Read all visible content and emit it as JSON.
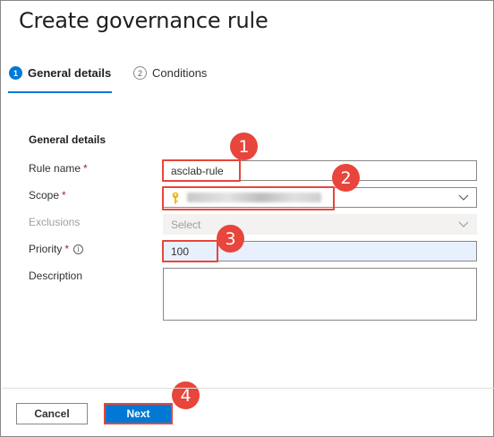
{
  "dialog": {
    "title": "Create governance rule"
  },
  "steps": [
    {
      "number": "1",
      "label": "General details",
      "active": true
    },
    {
      "number": "2",
      "label": "Conditions",
      "active": false
    }
  ],
  "form": {
    "section_title": "General details",
    "rule_name": {
      "label": "Rule name",
      "required_mark": "*",
      "value": "asclab-rule"
    },
    "scope": {
      "label": "Scope",
      "required_mark": "*",
      "value_redacted": true
    },
    "exclusions": {
      "label": "Exclusions",
      "placeholder": "Select",
      "disabled": true
    },
    "priority": {
      "label": "Priority",
      "required_mark": "*",
      "info_icon": "ⓘ",
      "value": "100"
    },
    "description": {
      "label": "Description",
      "value": ""
    }
  },
  "footer": {
    "cancel_label": "Cancel",
    "next_label": "Next"
  },
  "annotations": [
    "1",
    "2",
    "3",
    "4"
  ],
  "colors": {
    "accent": "#0078d4",
    "annotation": "#e8453c",
    "required": "#a4262c"
  }
}
